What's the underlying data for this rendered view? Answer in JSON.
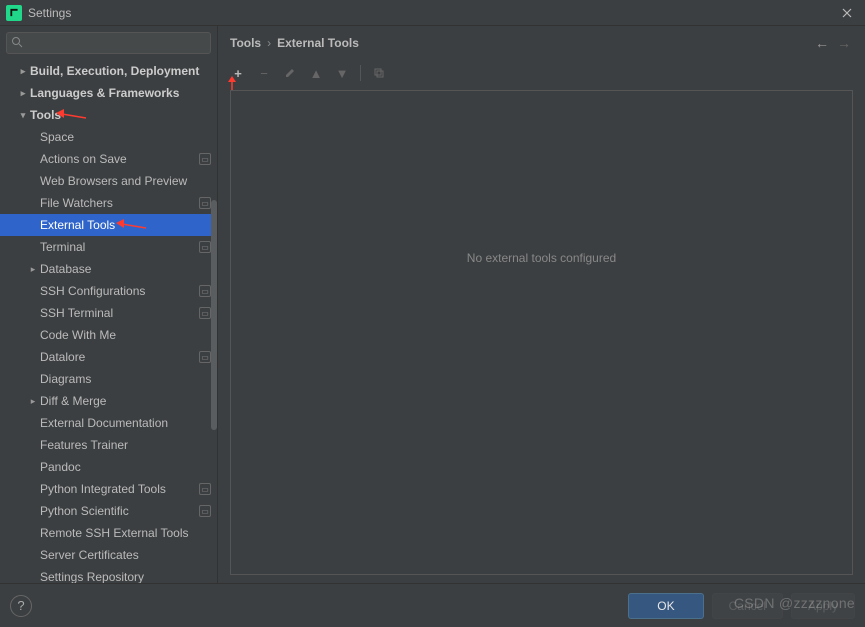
{
  "window": {
    "title": "Settings"
  },
  "search": {
    "placeholder": ""
  },
  "sidebar": {
    "items": [
      {
        "label": "Build, Execution, Deployment",
        "level": 1,
        "caret": "right"
      },
      {
        "label": "Languages & Frameworks",
        "level": 1,
        "caret": "right"
      },
      {
        "label": "Tools",
        "level": 1,
        "caret": "down",
        "arrow_annot": true
      },
      {
        "label": "Space",
        "level": 2
      },
      {
        "label": "Actions on Save",
        "level": 2,
        "badge": true
      },
      {
        "label": "Web Browsers and Preview",
        "level": 2
      },
      {
        "label": "File Watchers",
        "level": 2,
        "badge": true
      },
      {
        "label": "External Tools",
        "level": 2,
        "selected": true,
        "arrow_annot": true
      },
      {
        "label": "Terminal",
        "level": 2,
        "badge": true
      },
      {
        "label": "Database",
        "level": 2,
        "caret": "right"
      },
      {
        "label": "SSH Configurations",
        "level": 2,
        "badge": true
      },
      {
        "label": "SSH Terminal",
        "level": 2,
        "badge": true
      },
      {
        "label": "Code With Me",
        "level": 2
      },
      {
        "label": "Datalore",
        "level": 2,
        "badge": true
      },
      {
        "label": "Diagrams",
        "level": 2
      },
      {
        "label": "Diff & Merge",
        "level": 2,
        "caret": "right"
      },
      {
        "label": "External Documentation",
        "level": 2
      },
      {
        "label": "Features Trainer",
        "level": 2
      },
      {
        "label": "Pandoc",
        "level": 2
      },
      {
        "label": "Python Integrated Tools",
        "level": 2,
        "badge": true
      },
      {
        "label": "Python Scientific",
        "level": 2,
        "badge": true
      },
      {
        "label": "Remote SSH External Tools",
        "level": 2
      },
      {
        "label": "Server Certificates",
        "level": 2
      },
      {
        "label": "Settings Repository",
        "level": 2
      }
    ]
  },
  "breadcrumb": {
    "root": "Tools",
    "current": "External Tools"
  },
  "main": {
    "empty_message": "No external tools configured"
  },
  "footer": {
    "ok": "OK",
    "cancel": "Cancel",
    "apply": "Apply"
  },
  "watermark": "CSDN @zzzznone"
}
